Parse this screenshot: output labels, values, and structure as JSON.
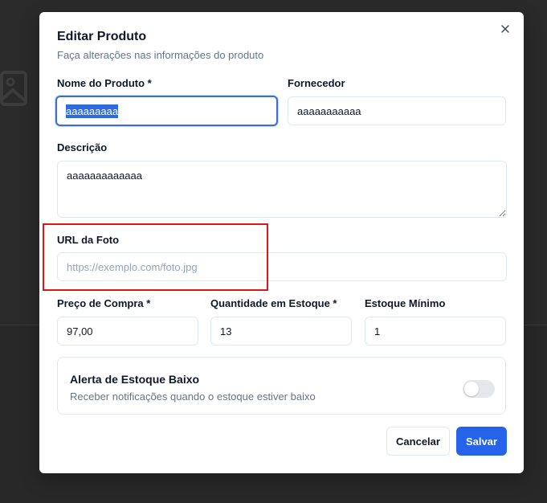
{
  "dialog": {
    "title": "Editar Produto",
    "subtitle": "Faça alterações nas informações do produto"
  },
  "fields": {
    "name": {
      "label": "Nome do Produto *",
      "value": "aaaaaaaaa"
    },
    "supplier": {
      "label": "Fornecedor",
      "value": "aaaaaaaaaaa"
    },
    "description": {
      "label": "Descrição",
      "value": "aaaaaaaaaaaaa"
    },
    "photo_url": {
      "label": "URL da Foto",
      "value": "",
      "placeholder": "https://exemplo.com/foto.jpg"
    },
    "purchase_price": {
      "label": "Preço de Compra *",
      "value": "97,00"
    },
    "stock_quantity": {
      "label": "Quantidade em Estoque *",
      "value": "13"
    },
    "min_stock": {
      "label": "Estoque Mínimo",
      "value": "1"
    }
  },
  "alert": {
    "title": "Alerta de Estoque Baixo",
    "description": "Receber notificações quando o estoque estiver baixo",
    "enabled": false
  },
  "actions": {
    "cancel_label": "Cancelar",
    "save_label": "Salvar"
  },
  "icons": {
    "close": "close-icon",
    "background_image": "image-icon"
  },
  "colors": {
    "primary": "#2563eb",
    "highlight": "#e01515",
    "focus_ring": "#3b6fd6"
  }
}
